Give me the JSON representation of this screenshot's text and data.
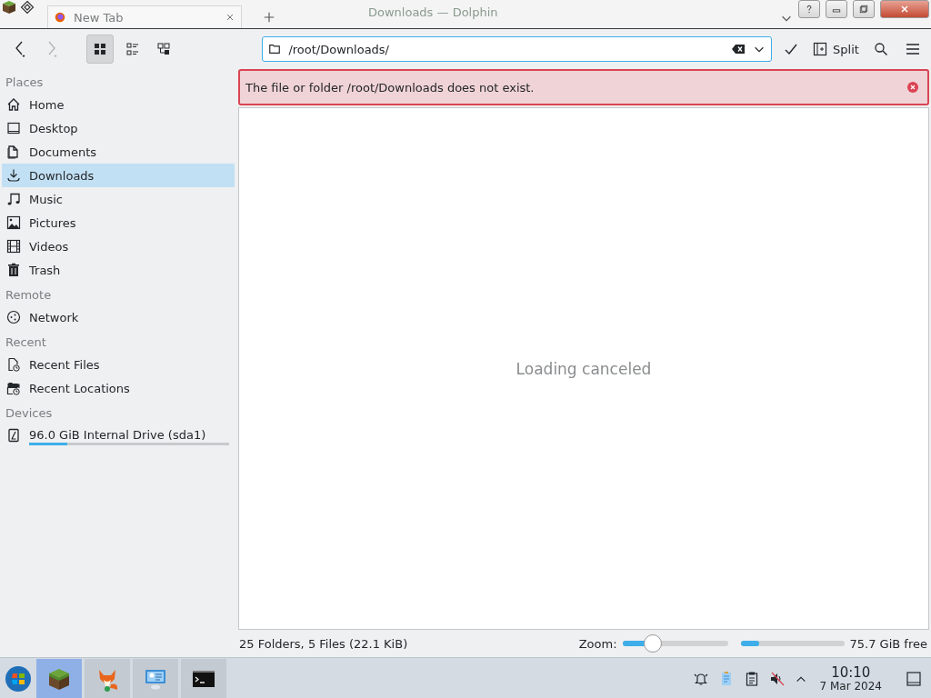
{
  "window": {
    "title": "Downloads — Dolphin"
  },
  "tabs": [
    {
      "label": "New Tab",
      "selected": true
    }
  ],
  "toolbar": {
    "location": "/root/Downloads/",
    "split_label": "Split"
  },
  "sidebar": {
    "sections": [
      {
        "heading": "Places",
        "items": [
          {
            "label": "Home",
            "kind": "home",
            "selected": false
          },
          {
            "label": "Desktop",
            "kind": "desktop",
            "selected": false
          },
          {
            "label": "Documents",
            "kind": "documents",
            "selected": false
          },
          {
            "label": "Downloads",
            "kind": "download",
            "selected": true
          },
          {
            "label": "Music",
            "kind": "music",
            "selected": false
          },
          {
            "label": "Pictures",
            "kind": "pictures",
            "selected": false
          },
          {
            "label": "Videos",
            "kind": "videos",
            "selected": false
          },
          {
            "label": "Trash",
            "kind": "trash",
            "selected": false
          }
        ]
      },
      {
        "heading": "Remote",
        "items": [
          {
            "label": "Network",
            "kind": "network",
            "selected": false
          }
        ]
      },
      {
        "heading": "Recent",
        "items": [
          {
            "label": "Recent Files",
            "kind": "recent",
            "selected": false
          },
          {
            "label": "Recent Locations",
            "kind": "recentfolder",
            "selected": false
          }
        ]
      },
      {
        "heading": "Devices",
        "items": [
          {
            "label": "96.0 GiB Internal Drive (sda1)",
            "kind": "drive",
            "selected": false,
            "level": 0.19
          }
        ]
      }
    ]
  },
  "error": {
    "message": "The file or folder /root/Downloads does not exist."
  },
  "view": {
    "message": "Loading canceled"
  },
  "status_bar": {
    "summary": "25 Folders, 5 Files (22.1 KiB)",
    "zoom_label": "Zoom:",
    "zoom": {
      "level": 0.29
    },
    "space": {
      "level": 0.18
    },
    "free": "75.7 GiB free"
  },
  "taskbar": {
    "apps": [
      {
        "kind": "cube",
        "selected": true
      },
      {
        "kind": "fox",
        "selected": false
      },
      {
        "kind": "monitor",
        "selected": false
      },
      {
        "kind": "terminal",
        "selected": false
      }
    ],
    "time": "10:10",
    "date": "7 Mar 2024"
  }
}
